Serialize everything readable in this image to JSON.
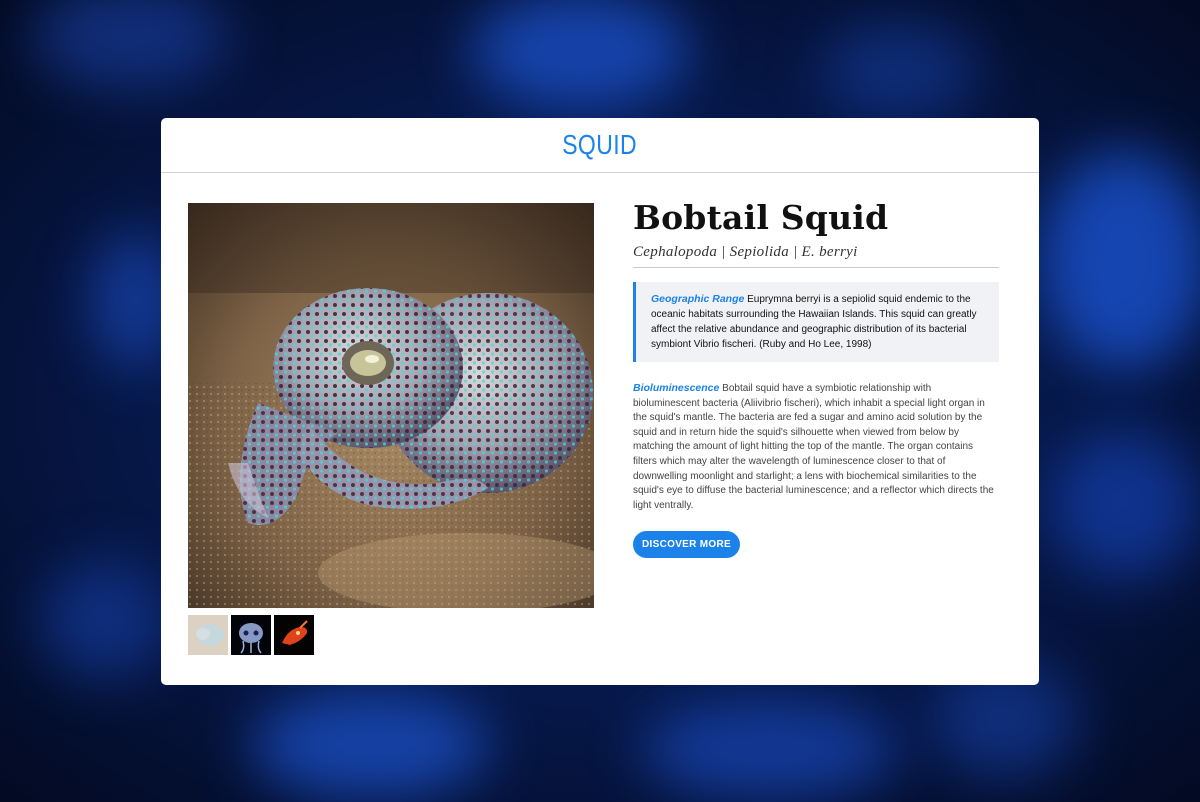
{
  "header": {
    "title": "SQUID"
  },
  "species": {
    "name": "Bobtail Squid",
    "taxonomy": "Cephalopoda | Sepiolida | E. berryi"
  },
  "geographic_range": {
    "label": "Geographic Range",
    "text": " Euprymna berryi is a sepiolid squid endemic to the oceanic habitats surrounding the Hawaiian Islands. This squid can greatly affect the relative abundance and geographic distribution of its bacterial symbiont Vibrio fischeri. (Ruby and Ho Lee, 1998)"
  },
  "bioluminescence": {
    "label": "Bioluminescence",
    "text": " Bobtail squid have a symbiotic relationship with bioluminescent bacteria (Aliivibrio fischeri), which inhabit a special light organ in the squid's mantle. The bacteria are fed a sugar and amino acid solution by the squid and in return hide the squid's silhouette when viewed from below by matching the amount of light hitting the top of the mantle. The organ contains filters which may alter the wavelength of luminescence closer to that of downwelling moonlight and starlight; a lens with biochemical similarities to the squid's eye to diffuse the bacterial luminescence; and a reflector which directs the light ventrally."
  },
  "cta": {
    "label": "DISCOVER MORE"
  },
  "colors": {
    "accent": "#1b82ea",
    "background": "#071a4f"
  }
}
